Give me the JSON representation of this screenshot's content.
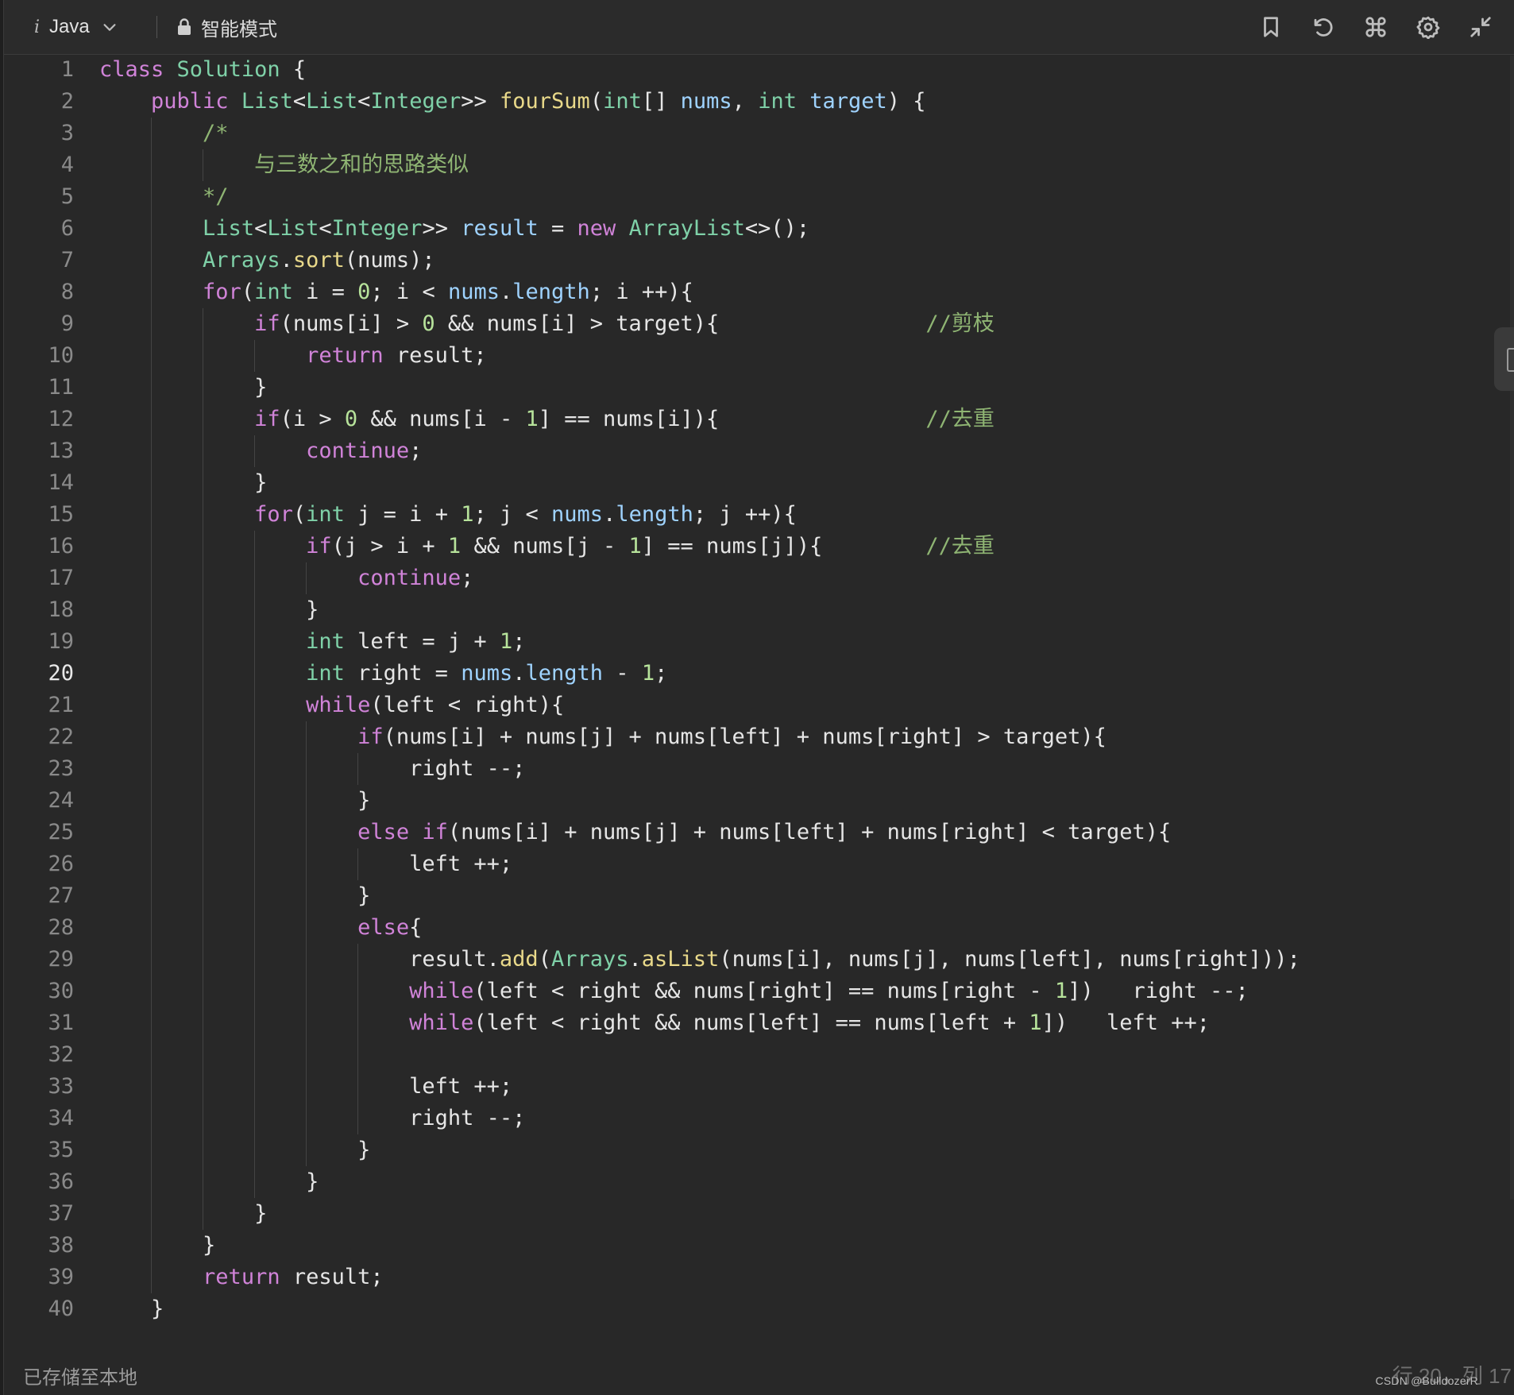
{
  "toolbar": {
    "info_label": "i",
    "language": "Java",
    "mode": "智能模式"
  },
  "code": {
    "active_line": 20,
    "lines": [
      "class Solution {",
      "    public List<List<Integer>> fourSum(int[] nums, int target) {",
      "        /*",
      "            与三数之和的思路类似",
      "        */",
      "        List<List<Integer>> result = new ArrayList<>();",
      "        Arrays.sort(nums);",
      "        for(int i = 0; i < nums.length; i ++){",
      "            if(nums[i] > 0 && nums[i] > target){                //剪枝",
      "                return result;",
      "            }",
      "            if(i > 0 && nums[i - 1] == nums[i]){                //去重",
      "                continue;",
      "            }",
      "            for(int j = i + 1; j < nums.length; j ++){",
      "                if(j > i + 1 && nums[j - 1] == nums[j]){        //去重",
      "                    continue;",
      "                }",
      "                int left = j + 1;",
      "                int right = nums.length - 1;",
      "                while(left < right){",
      "                    if(nums[i] + nums[j] + nums[left] + nums[right] > target){",
      "                        right --;",
      "                    }",
      "                    else if(nums[i] + nums[j] + nums[left] + nums[right] < target){",
      "                        left ++;",
      "                    }",
      "                    else{",
      "                        result.add(Arrays.asList(nums[i], nums[j], nums[left], nums[right]));",
      "                        while(left < right && nums[right] == nums[right - 1])   right --;",
      "                        while(left < right && nums[left] == nums[left + 1])   left ++;",
      "",
      "                        left ++;",
      "                        right --;",
      "                    }",
      "                }",
      "            }",
      "        }",
      "        return result;",
      "    }"
    ]
  },
  "status": {
    "saved_text": "已存储至本地",
    "position_text": "行 20，列 17",
    "watermark": "CSDN @BulldozerR"
  },
  "colors": {
    "background": "#282828",
    "keyword": "#d083d8",
    "type": "#7fd1a8",
    "function": "#e9d98a",
    "variable": "#9fd3ff",
    "number": "#b7e39b",
    "comment": "#8fb573"
  }
}
